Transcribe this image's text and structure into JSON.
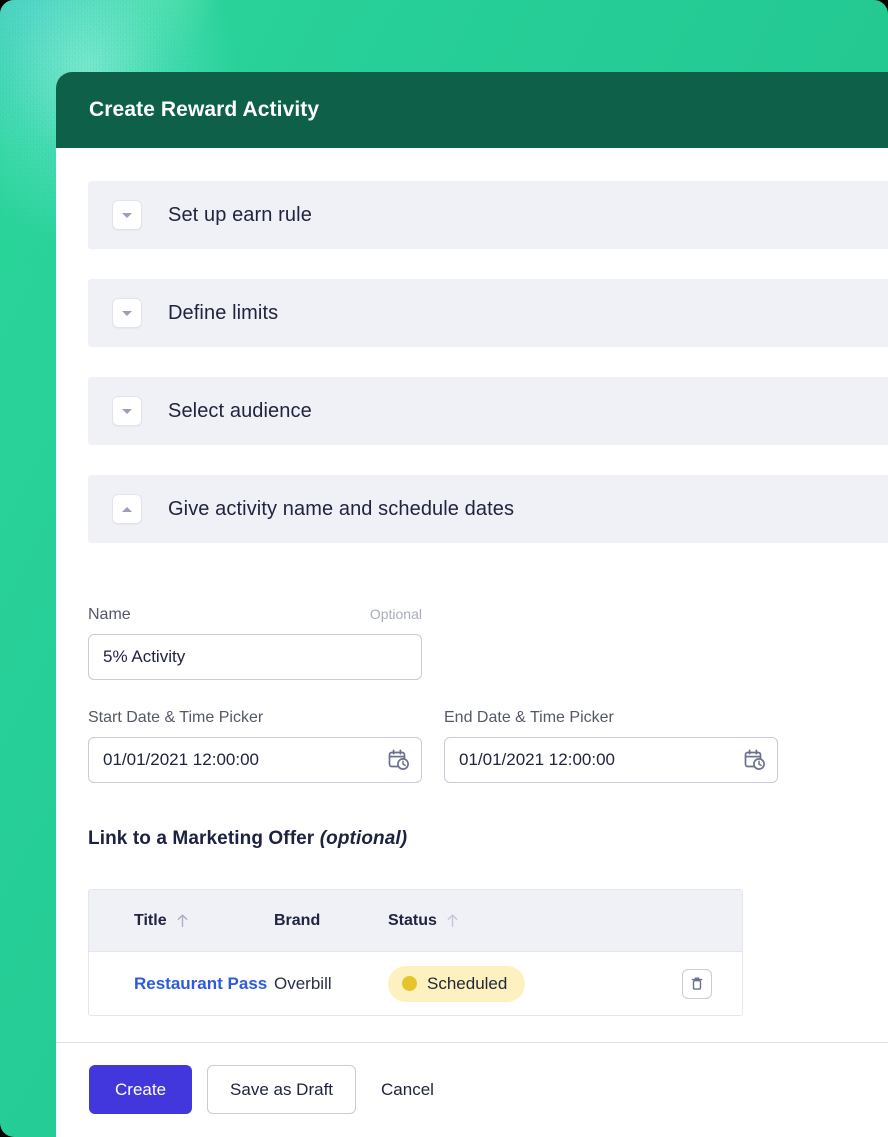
{
  "modal": {
    "title": "Create Reward Activity",
    "header_color": "#0e6049"
  },
  "accordion": {
    "sections": [
      {
        "label": "Set up earn rule",
        "icon": "chevron-down-icon",
        "expanded": false
      },
      {
        "label": "Define limits",
        "icon": "chevron-down-icon",
        "expanded": false
      },
      {
        "label": "Select audience",
        "icon": "chevron-down-icon",
        "expanded": false
      },
      {
        "label": "Give activity name and schedule dates",
        "icon": "chevron-up-icon",
        "expanded": true
      }
    ]
  },
  "form": {
    "name_label": "Name",
    "name_optional": "Optional",
    "name_value": "5% Activity",
    "name_placeholder": "Name",
    "start_label": "Start Date & Time Picker",
    "start_value": "01/01/2021 12:00:00",
    "end_label": "End Date & Time Picker",
    "end_value": "01/01/2021 12:00:00",
    "date_icon": "calendar-clock-icon"
  },
  "offer": {
    "heading_main": "Link to a Marketing Offer ",
    "heading_optional": "(optional)",
    "columns": [
      {
        "label": "Title",
        "sortable": true
      },
      {
        "label": "Brand",
        "sortable": false
      },
      {
        "label": "Status",
        "sortable": true
      }
    ],
    "rows": [
      {
        "title": "Restaurant Pass",
        "brand": "Overbill",
        "status": "Scheduled",
        "status_dot_color": "#e6c52b",
        "status_bg_color": "#fdf2bf",
        "delete_icon": "trash-icon"
      }
    ]
  },
  "footer": {
    "create_label": "Create",
    "draft_label": "Save as Draft",
    "cancel_label": "Cancel",
    "primary_color": "#4236dd"
  }
}
